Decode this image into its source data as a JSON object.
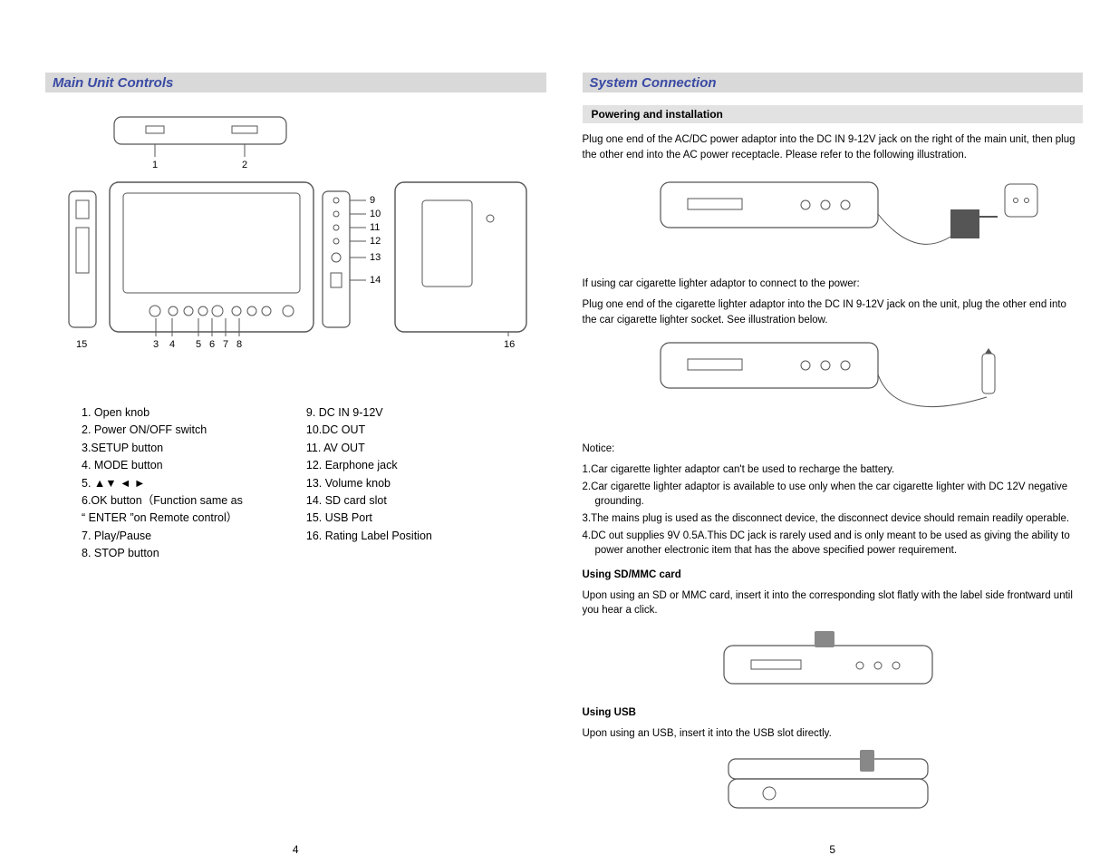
{
  "left": {
    "section_title": "Main Unit Controls",
    "callouts_top": [
      "1",
      "2"
    ],
    "callouts_right": [
      "9",
      "10",
      "11",
      "12",
      "13",
      "14"
    ],
    "callouts_bottom": [
      "15",
      "3",
      "4",
      "5",
      "6",
      "7",
      "8",
      "16"
    ],
    "legend_left": [
      "1. Open knob",
      "2. Power ON/OFF switch",
      "3.SETUP button",
      "4. MODE  button",
      "5. ▲▼ ◄ ►",
      "6.OK button（Function same as",
      "    “ ENTER ”on Remote control）",
      "7. Play/Pause",
      "8. STOP button"
    ],
    "legend_right": [
      "9.  DC IN 9-12V",
      "10.DC OUT",
      "11. AV OUT",
      "12. Earphone jack",
      "13. Volume knob",
      "14. SD card slot",
      "15. USB Port",
      "16. Rating Label Position"
    ],
    "page_number": "4"
  },
  "right": {
    "section_title": "System Connection",
    "sub_heading": "Powering and installation",
    "para1": "Plug one end of the AC/DC power adaptor into the DC IN 9-12V  jack on the right of the main unit, then plug the other end into the AC power receptacle.  Please refer to the following illustration.",
    "para2a": "If using car cigarette lighter adaptor to connect to the power:",
    "para2b": "Plug one end of the cigarette lighter adaptor into the DC IN 9-12V jack on the unit, plug the other end into the car cigarette lighter socket. See  illustration below.",
    "notice_heading": "Notice:",
    "notices": [
      "1.Car cigarette lighter adaptor can't be used to recharge the battery.",
      "2.Car cigarette lighter adaptor is available to use only when the car cigarette lighter with DC 12V negative grounding.",
      "3.The mains plug is used as the disconnect device, the disconnect device should remain readily operable.",
      "4.DC out supplies 9V 0.5A.This DC jack is rarely used and is only meant to be used as giving the ability to power another electronic item that has the above specified power requirement."
    ],
    "sd_heading": "Using SD/MMC card",
    "sd_text": "Upon using an SD or MMC card, insert it into the corresponding slot flatly with the label side frontward until you hear a click.",
    "usb_heading": "Using USB",
    "usb_text": "Upon using an USB, insert it into the USB slot directly.",
    "page_number": "5"
  }
}
